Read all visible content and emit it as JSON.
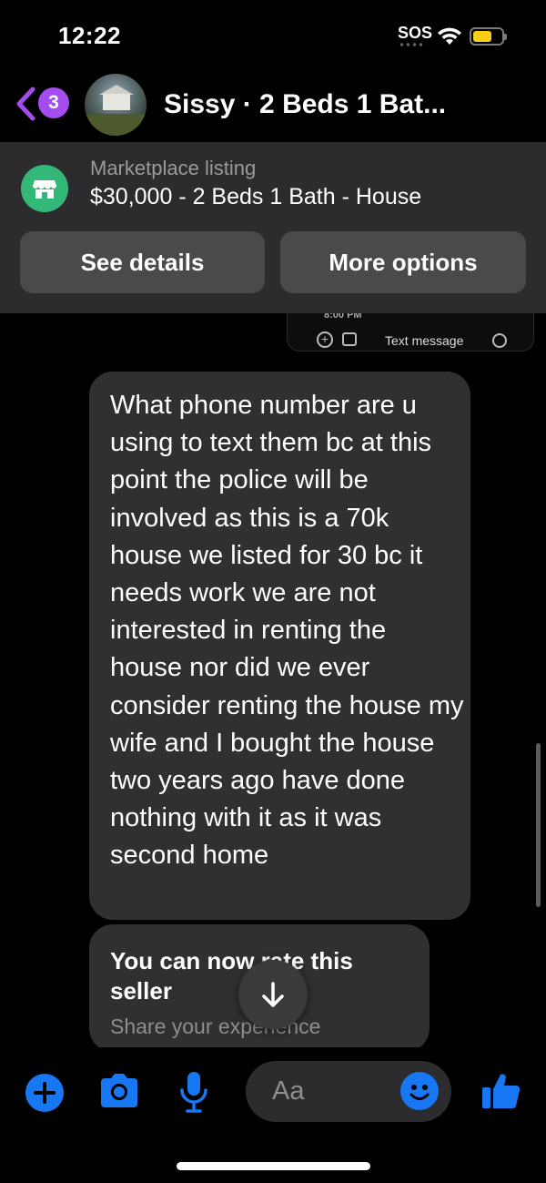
{
  "status_bar": {
    "time": "12:22",
    "carrier_text": "SOS",
    "battery_level": 0.6,
    "battery_color": "#f7d116"
  },
  "header": {
    "back_badge_count": "3",
    "chat_title": "Sissy · 2 Beds 1 Bat...",
    "accent_color": "#a54cf0",
    "icons": [
      "chevron-left-icon",
      "avatar"
    ]
  },
  "listing": {
    "subtitle": "Marketplace listing",
    "title": "$30,000 - 2 Beds 1 Bath - House",
    "see_details_label": "See details",
    "more_options_label": "More options",
    "icon": "marketplace-store-icon",
    "icon_color": "#33b87a"
  },
  "photo_peek": {
    "time_text": "8:00 PM",
    "field_text": "Text message"
  },
  "messages": [
    {
      "text": "What phone number are u using to text them bc at this point the police will be involved as this is a 70k house we listed for 30 bc it needs work we are not interested in renting the house nor did we ever consider renting the house my wife and I bought the house two years ago have done nothing with it as it was second home"
    }
  ],
  "rate_card": {
    "title": "You can now rate this seller",
    "subtitle": "Share your experience"
  },
  "composer": {
    "placeholder": "Aa",
    "accent_color": "#1877f2",
    "icons": [
      "plus-icon",
      "camera-icon",
      "microphone-icon",
      "emoji-icon",
      "thumbs-up-icon"
    ]
  }
}
